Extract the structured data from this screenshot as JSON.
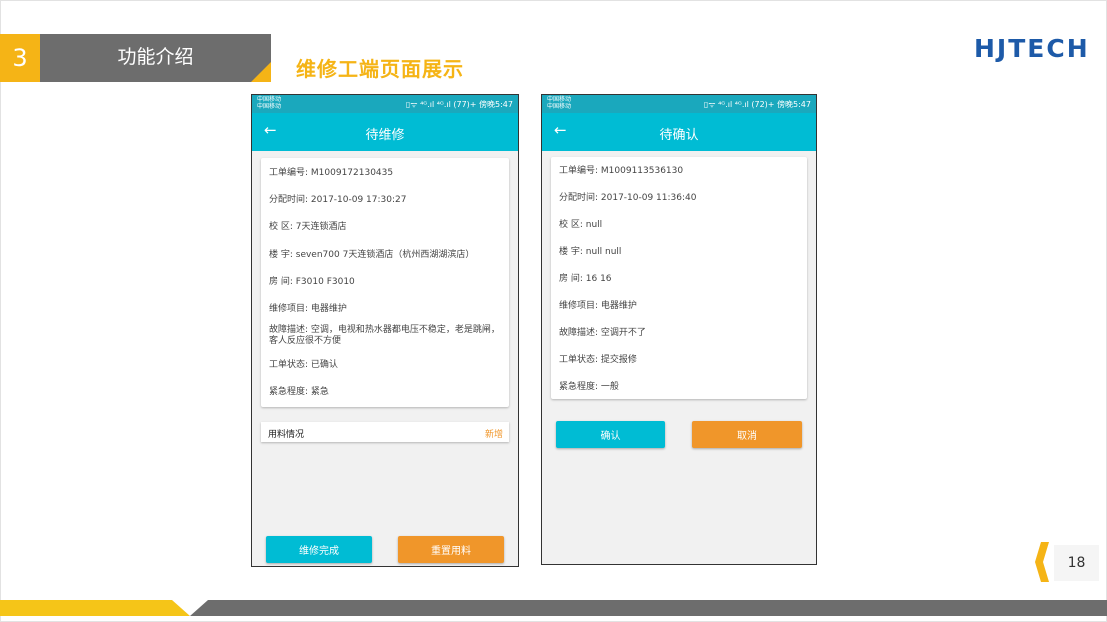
{
  "slide": {
    "section_number": "3",
    "section_title": "功能介绍",
    "title": "维修工端页面展示",
    "logo": "HJTECH",
    "page_number": "18",
    "accent_color": "#f5b416",
    "bar_color": "#6d6d6d"
  },
  "left_phone": {
    "status": {
      "carrier_top": "中国移动",
      "carrier_bottom": "中国移动",
      "right": "▯ᯤ ⁴ᴳ.ıl ⁴ᴳ.ıl (77)+ 傍晚5:47"
    },
    "appbar": {
      "back_icon": "←",
      "title": "待维修"
    },
    "fields": [
      "工单编号: M1009172130435",
      "分配时间: 2017-10-09 17:30:27",
      "校  区: 7天连锁酒店",
      "楼  宇: seven700   7天连锁酒店（杭州西湖湖滨店）",
      "房  间: F3010   F3010",
      "维修项目: 电器维护",
      "故障描述: 空调，电视和热水器都电压不稳定，老是跳闸，客人反应很不方便",
      "工单状态: 已确认",
      "紧急程度: 紧急"
    ],
    "material": {
      "label": "用料情况",
      "add": "新增"
    },
    "buttons": {
      "complete": "维修完成",
      "reset": "重置用料"
    }
  },
  "right_phone": {
    "status": {
      "carrier_top": "中国移动",
      "carrier_bottom": "中国移动",
      "right": "▯ᯤ ⁴ᴳ.ıl ⁴ᴳ.ıl (72)+ 傍晚5:47"
    },
    "appbar": {
      "back_icon": "←",
      "title": "待确认"
    },
    "fields": [
      "工单编号: M1009113536130",
      "分配时间: 2017-10-09 11:36:40",
      "校  区: null",
      "楼  宇: null   null",
      "房  间: 16   16",
      "维修项目: 电器维护",
      "故障描述: 空调开不了",
      "工单状态: 提交报修",
      "紧急程度: 一般"
    ],
    "buttons": {
      "confirm": "确认",
      "cancel": "取消"
    }
  }
}
